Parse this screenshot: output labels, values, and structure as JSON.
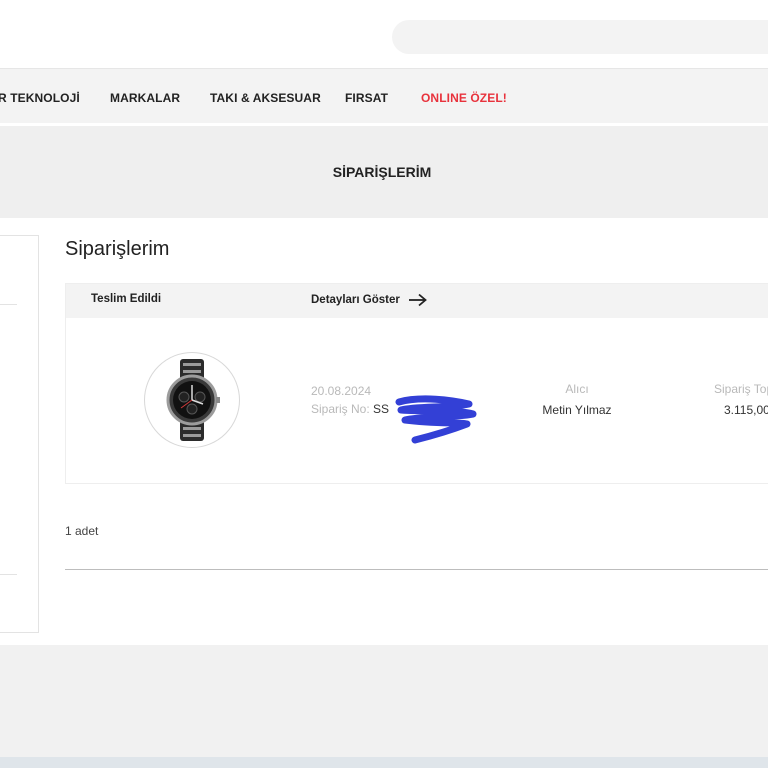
{
  "nav": {
    "items": [
      {
        "label": "R TEKNOLOJİ"
      },
      {
        "label": "MARKALAR"
      },
      {
        "label": "TAKI & AKSESUAR"
      },
      {
        "label": "FIRSAT"
      },
      {
        "label": "ONLINE ÖZEL!"
      }
    ]
  },
  "banner": {
    "title": "SİPARİŞLERİM"
  },
  "main": {
    "heading": "Siparişlerim"
  },
  "order": {
    "status": "Teslim Edildi",
    "details_label": "Detayları Göster",
    "date": "20.08.2024",
    "order_no_label": "Sipariş No:",
    "order_no_value": "SS",
    "recipient_label": "Alıcı",
    "recipient_name": "Metin Yılmaz",
    "total_label": "Sipariş Top",
    "total_value": "3.115,00"
  },
  "quantity": "1 adet",
  "colors": {
    "accent_red": "#e8323c",
    "redaction_blue": "#3340d6"
  }
}
